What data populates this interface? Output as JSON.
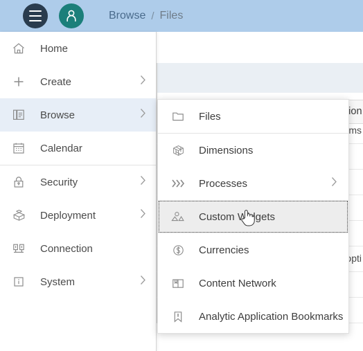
{
  "header": {
    "menu_icon": "hamburger-icon",
    "avatar_icon": "user-avatar-icon",
    "breadcrumb": {
      "parent": "Browse",
      "separator": "/",
      "current": "Files"
    },
    "bg_color": "#aeccea",
    "avatar_color": "#1b7f7a",
    "burger_color": "#2a3c4e"
  },
  "background": {
    "table": {
      "columns": [
        "Description"
      ],
      "sort_icon": "sort-ascending-icon",
      "clipped_cells": [
        "ms",
        "opti"
      ]
    }
  },
  "sidebar": {
    "items": [
      {
        "label": "Home",
        "icon": "home-icon",
        "chevron": false,
        "active": false
      },
      {
        "label": "Create",
        "icon": "plus-icon",
        "chevron": true,
        "active": false
      },
      {
        "label": "Browse",
        "icon": "browse-icon",
        "chevron": true,
        "active": true
      },
      {
        "label": "Calendar",
        "icon": "calendar-icon",
        "chevron": false,
        "active": false
      },
      {
        "label": "Security",
        "icon": "lock-icon",
        "chevron": true,
        "active": false
      },
      {
        "label": "Deployment",
        "icon": "package-icon",
        "chevron": true,
        "active": false
      },
      {
        "label": "Connection",
        "icon": "connection-icon",
        "chevron": false,
        "active": false
      },
      {
        "label": "System",
        "icon": "info-icon",
        "chevron": true,
        "active": false
      }
    ]
  },
  "submenu": {
    "items": [
      {
        "label": "Files",
        "icon": "folder-icon",
        "chevron": false,
        "hovered": false
      },
      {
        "label": "Dimensions",
        "icon": "cube-icon",
        "chevron": false,
        "hovered": false
      },
      {
        "label": "Processes",
        "icon": "chevrons-icon",
        "chevron": true,
        "hovered": false
      },
      {
        "label": "Custom Widgets",
        "icon": "shapes-icon",
        "chevron": false,
        "hovered": true
      },
      {
        "label": "Currencies",
        "icon": "dollar-icon",
        "chevron": false,
        "hovered": false
      },
      {
        "label": "Content Network",
        "icon": "book-icon",
        "chevron": false,
        "hovered": false
      },
      {
        "label": "Analytic Application Bookmarks",
        "icon": "bookmark-icon",
        "chevron": false,
        "hovered": false
      }
    ]
  },
  "cursor": {
    "type": "pointer-hand-cursor"
  }
}
